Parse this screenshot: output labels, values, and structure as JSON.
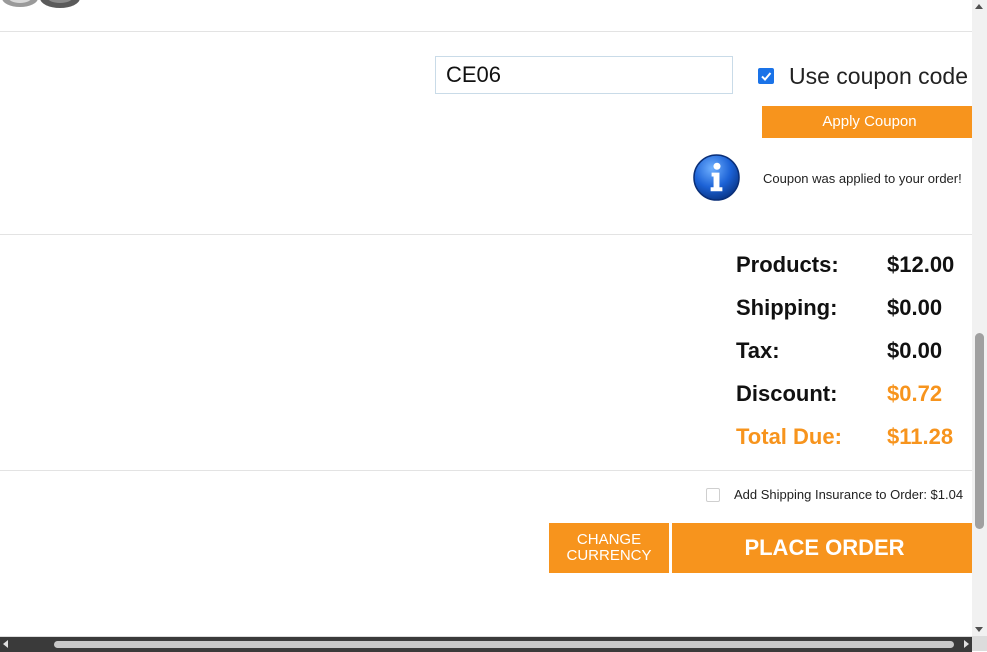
{
  "coupon": {
    "input_value": "CE06",
    "use_coupon_label": "Use coupon code",
    "use_coupon_checked": true,
    "apply_label": "Apply Coupon",
    "message": "Coupon was applied to your order!"
  },
  "totals": {
    "products_label": "Products:",
    "products_value": "$12.00",
    "shipping_label": "Shipping:",
    "shipping_value": "$0.00",
    "tax_label": "Tax:",
    "tax_value": "$0.00",
    "discount_label": "Discount:",
    "discount_value": "$0.72",
    "total_label": "Total Due:",
    "total_value": "$11.28"
  },
  "insurance": {
    "label": "Add Shipping Insurance to Order: $1.04",
    "checked": false
  },
  "actions": {
    "change_currency_line1": "CHANGE",
    "change_currency_line2": "CURRENCY",
    "place_order_label": "PLACE ORDER"
  },
  "colors": {
    "accent": "#f7941d",
    "checkbox": "#1a73e8",
    "info_icon": "#1565c0"
  },
  "icons": {
    "info": "info-icon",
    "check": "checkmark-icon"
  }
}
